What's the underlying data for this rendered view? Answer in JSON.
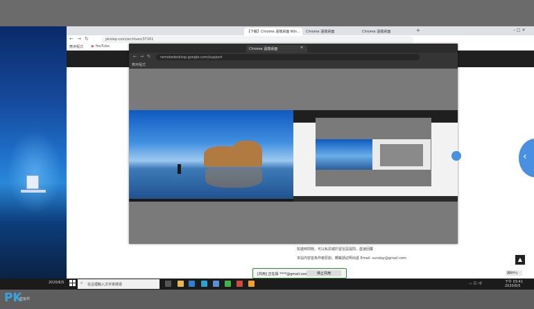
{
  "outer_browser": {
    "tabs": [
      "【下載】Chrome 遠端桌面 Win…",
      "Chrome 遠端桌面",
      "Chrome 遠端桌面"
    ],
    "url": "pkstep.com/archives/37161",
    "bookmarks": [
      "應用程式",
      "YouTube"
    ],
    "new_tab": "+"
  },
  "cast_window": {
    "tab_label": "Chrome 遠端桌面",
    "url": "remotedesktop.google.com/support",
    "bookmark": "應用程式"
  },
  "page_text": {
    "line1": "如遇到問題，可以私訊或於留言區提問，盡速回覆",
    "line2": "本站內容皆為作者原創，轉載請註明出處 Email: sunday@gmail.com",
    "link": "pkstep@gmail.com"
  },
  "share_bar": {
    "message": "[共用] 正在與 ****@gmail.com 共用畫面",
    "stop_button": "停止共用"
  },
  "taskbar": {
    "search_placeholder": "在這裡輸入文字來搜尋",
    "time": "下午 03:41",
    "date": "2020/6/5"
  },
  "notification": "通知中心",
  "left_time": "2020/6/5",
  "watermark": {
    "logo": "PK",
    "sub": "痞客邦"
  },
  "colors": {
    "accent": "#4a90e2",
    "share_border": "#2d8a3a",
    "link": "#e08a00"
  }
}
